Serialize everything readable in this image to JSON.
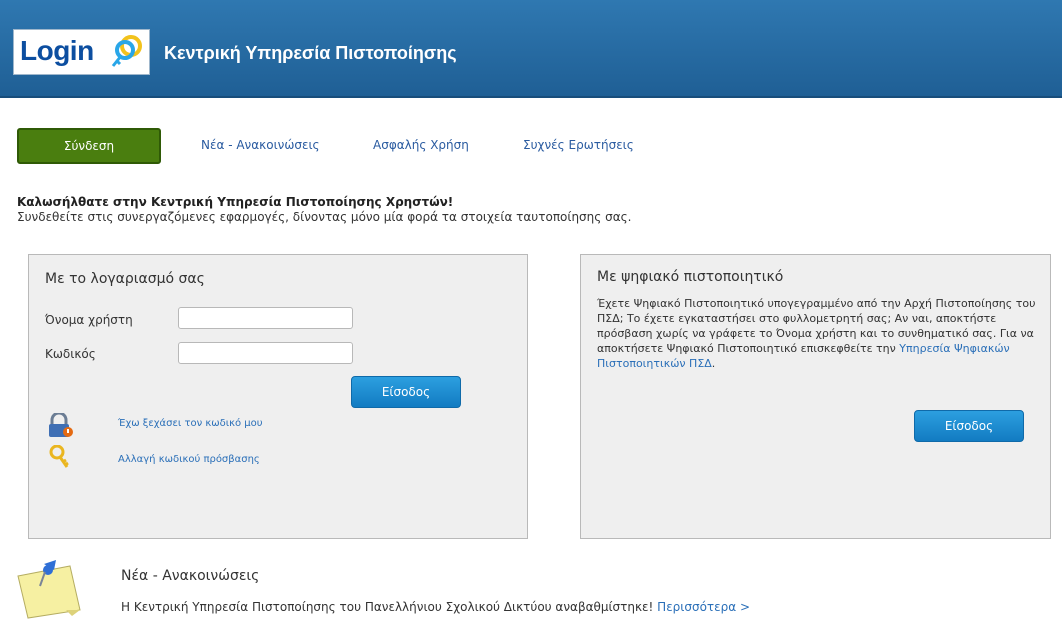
{
  "header": {
    "logo": {
      "main": "Login",
      "accent": ""
    },
    "title": "Κεντρική Υπηρεσία Πιστοποίησης"
  },
  "nav": {
    "active": "Σύνδεση",
    "items": [
      "Νέα - Ανακοινώσεις",
      "Ασφαλής Χρήση",
      "Συχνές Ερωτήσεις"
    ]
  },
  "welcome": {
    "title": "Καλωσήλθατε στην Κεντρική Υπηρεσία Πιστοποίησης Χρηστών!",
    "subtitle": "Συνδεθείτε στις συνεργαζόμενες εφαρμογές, δίνοντας μόνο μία φορά τα στοιχεία ταυτοποίησης σας."
  },
  "account_panel": {
    "title": "Με το λογαριασμό σας",
    "username_label": "Όνομα χρήστη",
    "password_label": "Κωδικός",
    "username_value": "",
    "password_value": "",
    "login_button": "Είσοδος",
    "forgot_link": "Έχω ξεχάσει τον κωδικό μου",
    "change_link": "Αλλαγή κωδικού πρόσβασης"
  },
  "cert_panel": {
    "title": "Με ψηφιακό πιστοποιητικό",
    "text": "Έχετε Ψηφιακό Πιστοποιητικό υπογεγραμμένο από την Αρχή Πιστοποίησης του ΠΣΔ; Το έχετε εγκαταστήσει στο φυλλομετρητή σας; Αν ναι, αποκτήστε πρόσβαση χωρίς να γράφετε το Όνομα χρήστη και το συνθηματικό σας. Για να αποκτήσετε Ψηφιακό Πιστοποιητικό επισκεφθείτε την ",
    "link_text": "Υπηρεσία Ψηφιακών Πιστοποιητικών ΠΣΔ",
    "text_end": ".",
    "login_button": "Είσοδος"
  },
  "news": {
    "title": "Νέα - Ανακοινώσεις",
    "text": "Η Κεντρική Υπηρεσία Πιστοποίησης του Πανελλήνιου Σχολικού Δικτύου αναβαθμίστηκε! ",
    "more": "Περισσότερα >"
  },
  "colors": {
    "header": "#2a6fa8",
    "nav_active": "#4a7e0f",
    "button": "#1a8ad2",
    "link": "#2a6fb8"
  }
}
